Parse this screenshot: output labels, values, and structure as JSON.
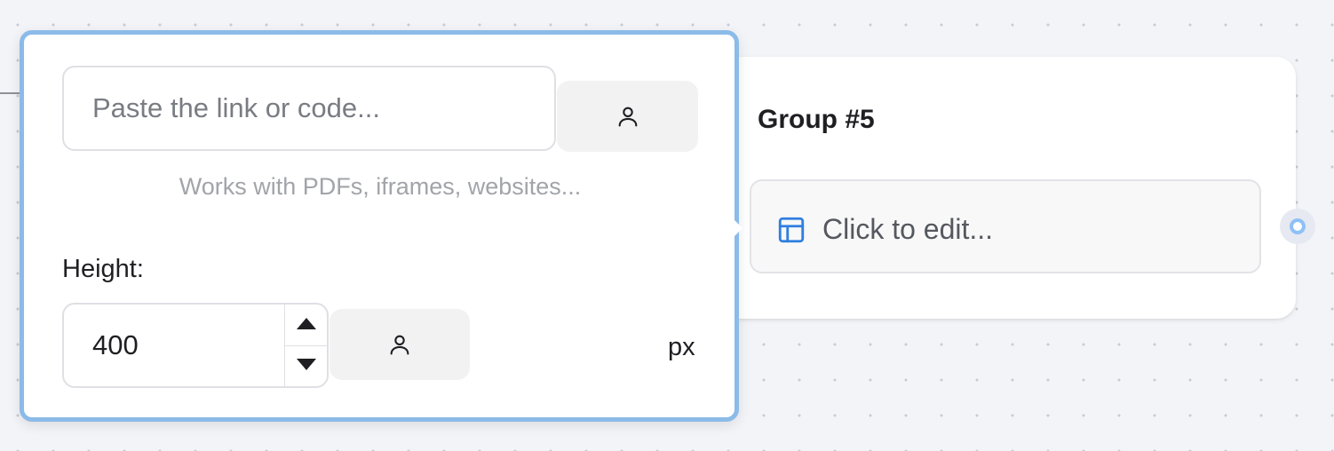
{
  "popover": {
    "link_input_placeholder": "Paste the link or code...",
    "link_input_value": "",
    "link_button_icon": "person-icon",
    "hint": "Works with PDFs, iframes, websites...",
    "height_label": "Height:",
    "height_value": "400",
    "height_button_icon": "person-icon",
    "unit": "px",
    "border_color": "#8bbbe8"
  },
  "group_node": {
    "title": "Group #5",
    "edit_placeholder": "Click to edit...",
    "edit_icon": "layout-icon",
    "icon_color": "#2f7fe0"
  },
  "handle_color": "#8ec1f6"
}
